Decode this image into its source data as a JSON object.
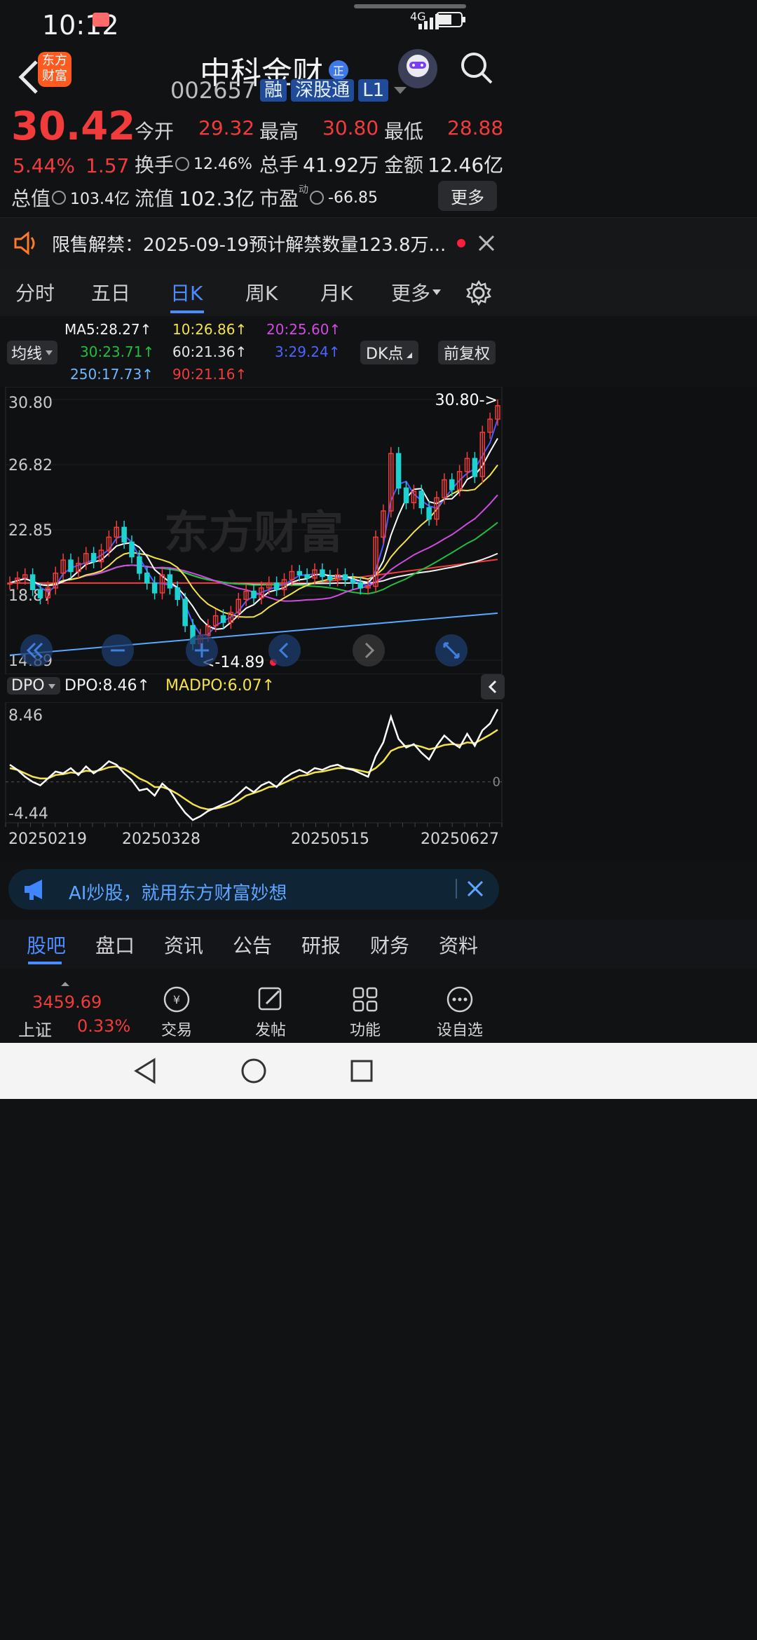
{
  "status": {
    "time": "10:12",
    "network": "4G"
  },
  "header": {
    "logo_text_top": "东方",
    "logo_text_bottom": "财富",
    "stock_name": "中科金财",
    "badge": "正",
    "code": "002657",
    "tags": [
      "融",
      "深股通",
      "L1"
    ]
  },
  "quote": {
    "price": "30.42",
    "change_pct": "5.44%",
    "change": "1.57",
    "open_label": "今开",
    "open": "29.32",
    "high_label": "最高",
    "high": "30.80",
    "low_label": "最低",
    "low": "28.88",
    "turnover_label": "换手",
    "turnover": "12.46%",
    "volume_label": "总手",
    "volume": "41.92万",
    "amount_label": "金额",
    "amount": "12.46亿",
    "mkt_cap_label": "总值",
    "mkt_cap": "103.4亿",
    "float_cap_label": "流值",
    "float_cap": "102.3亿",
    "pe_label": "市盈",
    "pe_super": "动",
    "pe": "-66.85",
    "more": "更多"
  },
  "notice": {
    "text": "限售解禁：2025-09-19预计解禁数量123.8万..."
  },
  "tabs": [
    {
      "label": "分时"
    },
    {
      "label": "五日"
    },
    {
      "label": "日K"
    },
    {
      "label": "周K"
    },
    {
      "label": "月K"
    },
    {
      "label": "更多"
    }
  ],
  "ma": {
    "selector": "均线",
    "ma5": "MA5:28.27↑",
    "ma10": "10:26.86↑",
    "ma20": "20:25.60↑",
    "ma30": "30:23.71↑",
    "ma60": "60:21.36↑",
    "ma3": "3:29.24↑",
    "ma250": "250:17.73↑",
    "ma90": "90:21.16↑",
    "dk": "DK点",
    "adj": "前复权"
  },
  "chart_data": {
    "type": "candlestick",
    "watermark": "东方财富",
    "y_ticks": [
      "30.80",
      "26.82",
      "22.85",
      "18.87",
      "14.89"
    ],
    "ylim": [
      14.89,
      30.8
    ],
    "max_label": "30.80->",
    "min_label": "<-14.89",
    "x_ticks": [
      "20250219",
      "20250328",
      "20250515",
      "20250627"
    ],
    "ma_colors": {
      "ma5": "#ffffff",
      "ma10": "#f3e24b",
      "ma20": "#d04be0",
      "ma30": "#1fbf3f",
      "ma60": "#f2f2f2",
      "ma3": "#4b5bff",
      "ma250": "#5aa8ff",
      "ma90": "#f23b3b"
    },
    "close": [
      19.6,
      19.9,
      20.1,
      19.2,
      18.7,
      19.3,
      20.2,
      21.0,
      20.3,
      20.8,
      21.4,
      20.9,
      21.6,
      22.4,
      23.0,
      22.1,
      21.2,
      20.2,
      19.6,
      19.0,
      20.1,
      19.3,
      18.6,
      17.0,
      15.9,
      16.4,
      17.0,
      17.6,
      17.2,
      17.8,
      18.6,
      19.1,
      18.7,
      19.3,
      19.6,
      19.2,
      19.8,
      20.3,
      20.1,
      19.9,
      20.4,
      20.0,
      19.8,
      20.1,
      19.8,
      19.6,
      19.3,
      19.4,
      22.4,
      24.0,
      27.5,
      25.4,
      24.5,
      25.2,
      24.2,
      23.5,
      24.8,
      25.9,
      25.3,
      26.4,
      27.2,
      26.1,
      28.8,
      29.6,
      30.42
    ]
  },
  "dpo": {
    "selector": "DPO",
    "dpo_label": "DPO:8.46↑",
    "madpo_label": "MADPO:6.07↑",
    "y_top": "8.46",
    "y_bottom": "-4.44",
    "y_zero": "0",
    "dpo": [
      2.0,
      1.4,
      0.6,
      0.0,
      -0.4,
      0.4,
      1.2,
      1.0,
      1.6,
      0.8,
      1.8,
      1.0,
      1.6,
      2.4,
      2.0,
      1.0,
      0.2,
      -1.0,
      -0.8,
      -1.6,
      -0.2,
      -1.0,
      -2.4,
      -3.6,
      -4.44,
      -4.0,
      -3.4,
      -3.0,
      -2.6,
      -2.2,
      -1.4,
      -0.6,
      -1.2,
      -0.4,
      0.0,
      -0.6,
      0.4,
      1.0,
      1.4,
      1.0,
      1.6,
      1.4,
      1.8,
      2.0,
      1.6,
      1.4,
      1.0,
      0.6,
      3.0,
      4.6,
      7.6,
      5.0,
      4.0,
      4.4,
      3.4,
      2.6,
      4.2,
      5.4,
      4.6,
      4.0,
      5.6,
      4.2,
      6.0,
      6.8,
      8.46
    ],
    "madpo": [
      1.6,
      1.4,
      1.0,
      0.6,
      0.4,
      0.4,
      0.8,
      0.9,
      1.1,
      1.0,
      1.3,
      1.2,
      1.4,
      1.7,
      1.8,
      1.5,
      1.0,
      0.4,
      0.0,
      -0.6,
      -0.6,
      -0.9,
      -1.4,
      -2.0,
      -2.6,
      -3.0,
      -3.2,
      -3.1,
      -2.9,
      -2.6,
      -2.2,
      -1.6,
      -1.3,
      -1.0,
      -0.6,
      -0.5,
      -0.1,
      0.3,
      0.7,
      0.8,
      1.1,
      1.2,
      1.4,
      1.6,
      1.6,
      1.5,
      1.3,
      1.1,
      1.6,
      2.4,
      3.6,
      4.0,
      4.2,
      4.3,
      4.1,
      3.8,
      4.0,
      4.3,
      4.4,
      4.3,
      4.6,
      4.5,
      5.0,
      5.5,
      6.07
    ]
  },
  "ai_banner": {
    "text": "AI炒股，就用东方财富妙想"
  },
  "bottom_tabs": [
    {
      "label": "股吧"
    },
    {
      "label": "盘口"
    },
    {
      "label": "资讯"
    },
    {
      "label": "公告"
    },
    {
      "label": "研报"
    },
    {
      "label": "财务"
    },
    {
      "label": "资料"
    }
  ],
  "bottom_nav": {
    "index_value": "3459.69",
    "index_name": "上证",
    "index_change": "0.33%",
    "items": [
      {
        "label": "交易"
      },
      {
        "label": "发帖"
      },
      {
        "label": "功能"
      },
      {
        "label": "设自选"
      }
    ]
  }
}
